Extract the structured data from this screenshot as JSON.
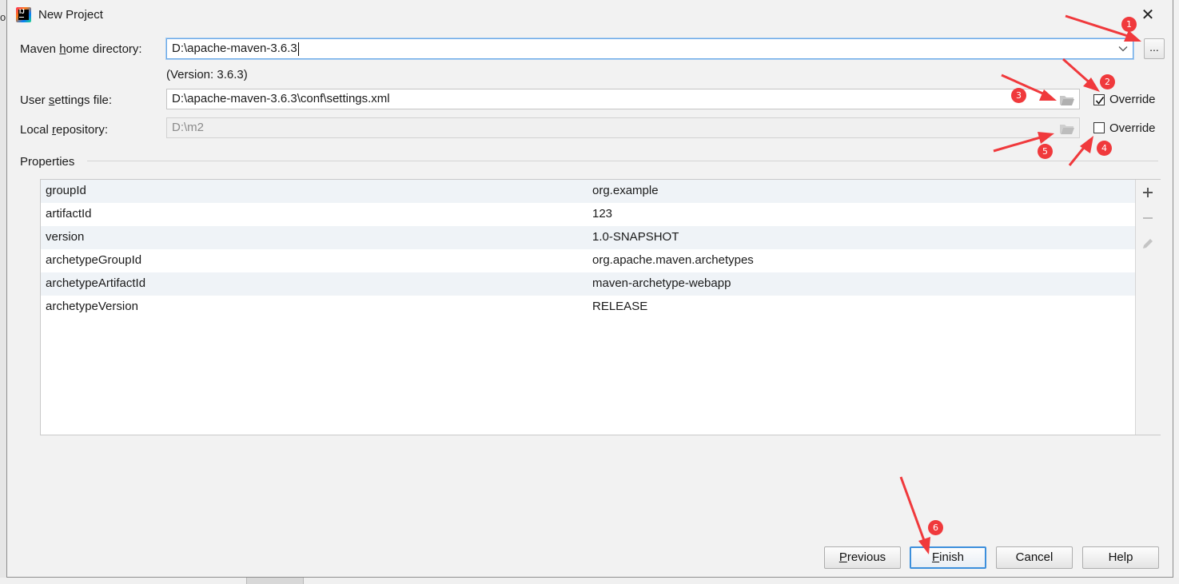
{
  "window": {
    "title": "New Project",
    "edge_fragment": "o"
  },
  "form": {
    "maven_home": {
      "label_pre": "Maven ",
      "label_underline": "h",
      "label_post": "ome directory:",
      "value": "D:\\apache-maven-3.6.3",
      "version_note": "(Version: 3.6.3)",
      "browse_label": "..."
    },
    "user_settings": {
      "label_pre": "User ",
      "label_underline": "s",
      "label_post": "ettings file:",
      "value": "D:\\apache-maven-3.6.3\\conf\\settings.xml",
      "override_label": "Override",
      "override_checked": true
    },
    "local_repo": {
      "label_pre": "Local ",
      "label_underline": "r",
      "label_post": "epository:",
      "value": "D:\\m2",
      "override_label": "Override",
      "override_checked": false
    }
  },
  "properties": {
    "heading": "Properties",
    "rows": [
      {
        "key": "groupId",
        "value": "org.example"
      },
      {
        "key": "artifactId",
        "value": "123"
      },
      {
        "key": "version",
        "value": "1.0-SNAPSHOT"
      },
      {
        "key": "archetypeGroupId",
        "value": "org.apache.maven.archetypes"
      },
      {
        "key": "archetypeArtifactId",
        "value": "maven-archetype-webapp"
      },
      {
        "key": "archetypeVersion",
        "value": "RELEASE"
      }
    ],
    "toolbar": {
      "add_icon": "plus-icon",
      "remove_icon": "minus-icon",
      "edit_icon": "pencil-icon"
    }
  },
  "buttons": {
    "previous_underline": "P",
    "previous_rest": "revious",
    "finish_underline": "F",
    "finish_rest": "inish",
    "cancel": "Cancel",
    "help": "Help"
  },
  "annotations": {
    "badge_1": "1",
    "badge_2": "2",
    "badge_3": "3",
    "badge_4": "4",
    "badge_5": "5",
    "badge_6": "6",
    "color": "#f0393c"
  }
}
